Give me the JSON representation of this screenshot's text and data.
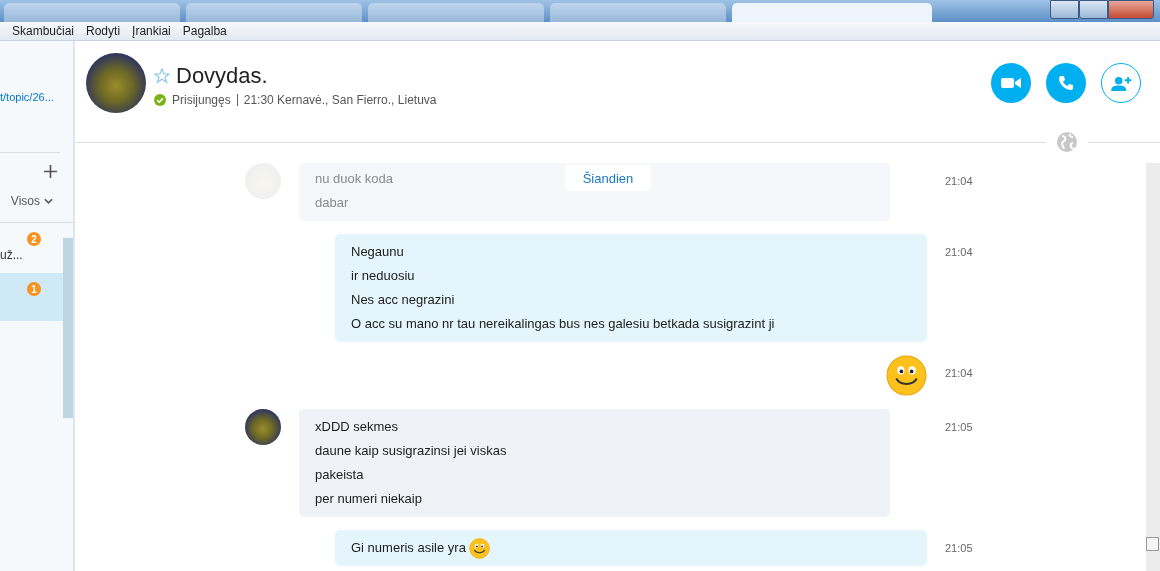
{
  "titlebar": {
    "tabs": [
      {
        "selected": false
      },
      {
        "selected": false
      },
      {
        "selected": false
      },
      {
        "selected": false
      },
      {
        "selected": true
      }
    ]
  },
  "menu": [
    "Skambučiai",
    "Rodyti",
    "Įrankiai",
    "Pagalba"
  ],
  "sidebar": {
    "link": "t/topic/26...",
    "filter": "Visos",
    "items": [
      {
        "text": "už...",
        "badge": "2",
        "selected": false
      },
      {
        "badge": "1",
        "selected": true
      }
    ]
  },
  "contact": {
    "name": "Dovydas.",
    "status": "Prisijungęs",
    "online": true,
    "info": "21:30 Kernavė., San Fierro., Lietuva",
    "favorite": false
  },
  "date_divider": "Šiandien",
  "messages": [
    {
      "kind": "incoming",
      "faded": true,
      "lines": [
        "nu duok koda",
        "dabar"
      ],
      "time": "21:04"
    },
    {
      "kind": "outgoing",
      "lines": [
        "Negaunu",
        "ir neduosiu",
        "Nes acc negrazini",
        "O acc su mano nr tau nereikalingas bus nes galesiu betkada susigrazint ji"
      ],
      "time": "21:04"
    },
    {
      "kind": "emoticon",
      "time": "21:04"
    },
    {
      "kind": "incoming",
      "faded": false,
      "lines": [
        "xDDD sekmes",
        "daune kaip susigrazinsi jei viskas",
        "pakeista",
        "per numeri niekaip"
      ],
      "time": "21:05"
    },
    {
      "kind": "outgoing",
      "lines": [
        "Gi numeris asile yra"
      ],
      "smiley": true,
      "time": "21:05"
    }
  ]
}
